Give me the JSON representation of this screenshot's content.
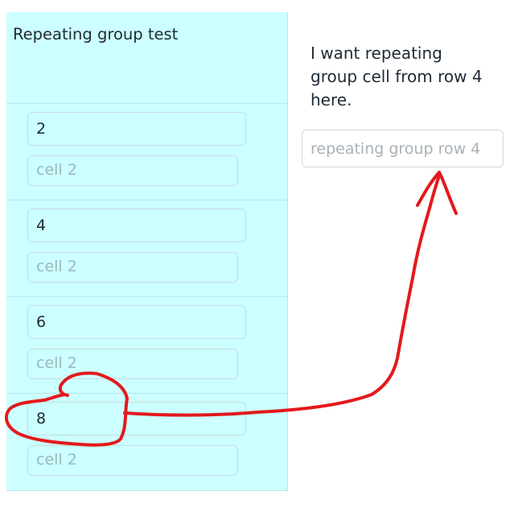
{
  "repeating_group": {
    "title": "Repeating group test",
    "cells": [
      {
        "value": "2",
        "cell_placeholder": "cell 2"
      },
      {
        "value": "4",
        "cell_placeholder": "cell 2"
      },
      {
        "value": "6",
        "cell_placeholder": "cell 2"
      },
      {
        "value": "8",
        "cell_placeholder": "cell 2"
      }
    ]
  },
  "side": {
    "instruction": "I want repeating group cell from row 4 here.",
    "input_placeholder": "repeating group row 4"
  },
  "colors": {
    "rg_background": "#ccffff",
    "annotation_red": "#e3191c"
  },
  "icons": {
    "annotation": "hand-drawn-circle-and-arrow"
  }
}
